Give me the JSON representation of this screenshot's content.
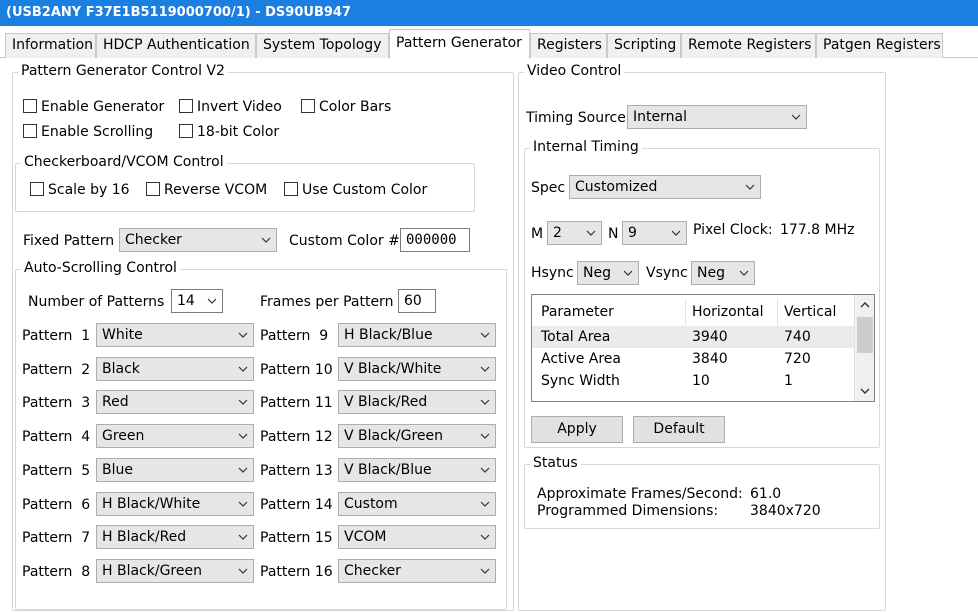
{
  "window": {
    "title": "(USB2ANY F37E1B5119000700/1) - DS90UB947"
  },
  "tabs": [
    {
      "label": "Information"
    },
    {
      "label": "HDCP Authentication"
    },
    {
      "label": "System Topology"
    },
    {
      "label": "Pattern Generator",
      "active": true
    },
    {
      "label": "Registers"
    },
    {
      "label": "Scripting"
    },
    {
      "label": "Remote Registers"
    },
    {
      "label": "Patgen Registers"
    }
  ],
  "pg_control": {
    "title": "Pattern Generator Control V2",
    "enable_generator": "Enable Generator",
    "invert_video": "Invert Video",
    "color_bars": "Color Bars",
    "enable_scrolling": "Enable Scrolling",
    "bit18_color": "18-bit Color"
  },
  "checkerboard": {
    "title": "Checkerboard/VCOM Control",
    "scale_by_16": "Scale by 16",
    "reverse_vcom": "Reverse VCOM",
    "use_custom_color": "Use Custom Color"
  },
  "fixed_pattern": {
    "label": "Fixed Pattern",
    "value": "Checker"
  },
  "custom_color": {
    "label": "Custom Color #",
    "value": "000000"
  },
  "auto_scroll": {
    "title": "Auto-Scrolling Control",
    "num_patterns_label": "Number of Patterns",
    "num_patterns_value": "14",
    "frames_per_pattern_label": "Frames per Pattern",
    "frames_per_pattern_value": "60",
    "patterns_left": [
      {
        "label": "Pattern  1",
        "value": "White"
      },
      {
        "label": "Pattern  2",
        "value": "Black"
      },
      {
        "label": "Pattern  3",
        "value": "Red"
      },
      {
        "label": "Pattern  4",
        "value": "Green"
      },
      {
        "label": "Pattern  5",
        "value": "Blue"
      },
      {
        "label": "Pattern  6",
        "value": "H Black/White"
      },
      {
        "label": "Pattern  7",
        "value": "H Black/Red"
      },
      {
        "label": "Pattern  8",
        "value": "H Black/Green"
      }
    ],
    "patterns_right": [
      {
        "label": "Pattern  9",
        "value": "H Black/Blue"
      },
      {
        "label": "Pattern 10",
        "value": "V Black/White"
      },
      {
        "label": "Pattern 11",
        "value": "V Black/Red"
      },
      {
        "label": "Pattern 12",
        "value": "V Black/Green"
      },
      {
        "label": "Pattern 13",
        "value": "V Black/Blue"
      },
      {
        "label": "Pattern 14",
        "value": "Custom"
      },
      {
        "label": "Pattern 15",
        "value": "VCOM"
      },
      {
        "label": "Pattern 16",
        "value": "Checker"
      }
    ]
  },
  "video_control": {
    "title": "Video Control",
    "timing_source_label": "Timing Source",
    "timing_source_value": "Internal",
    "internal_timing": {
      "title": "Internal Timing",
      "spec_label": "Spec",
      "spec_value": "Customized",
      "m_label": "M",
      "m_value": "2",
      "n_label": "N",
      "n_value": "9",
      "pixel_clock_label": "Pixel Clock:",
      "pixel_clock_value": "177.8 MHz",
      "hsync_label": "Hsync",
      "hsync_value": "Neg",
      "vsync_label": "Vsync",
      "vsync_value": "Neg",
      "table": {
        "columns": [
          "Parameter",
          "Horizontal",
          "Vertical"
        ],
        "rows": [
          [
            "Total Area",
            "3940",
            "740"
          ],
          [
            "Active Area",
            "3840",
            "720"
          ],
          [
            "Sync Width",
            "10",
            "1"
          ]
        ]
      },
      "apply_label": "Apply",
      "default_label": "Default"
    }
  },
  "status": {
    "title": "Status",
    "fps_label": "Approximate Frames/Second:",
    "fps_value": "61.0",
    "dims_label": "Programmed Dimensions:",
    "dims_value": "3840x720"
  }
}
